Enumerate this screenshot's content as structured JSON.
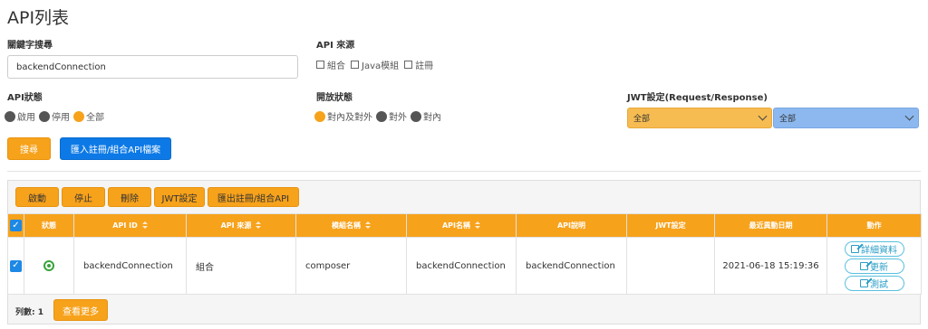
{
  "page": {
    "title": "API列表"
  },
  "filters": {
    "keyword_label": "關鍵字搜尋",
    "keyword_value": "backendConnection",
    "source_label": "API 來源",
    "source_options": [
      "組合",
      "Java模組",
      "註冊"
    ],
    "status_label": "API狀態",
    "status_options": [
      "啟用",
      "停用",
      "全部"
    ],
    "open_label": "開放狀態",
    "open_options": [
      "對內及對外",
      "對外",
      "對內"
    ],
    "jwt_label": "JWT設定(Request/Response)",
    "jwt_request_value": "全部",
    "jwt_response_value": "全部",
    "search_button": "搜尋",
    "import_button": "匯入註冊/組合API檔案"
  },
  "toolbar": {
    "enable": "啟動",
    "disable": "停止",
    "delete": "刪除",
    "jwt": "JWT設定",
    "export": "匯出註冊/組合API"
  },
  "table": {
    "headers": [
      "狀態",
      "API ID",
      "API 來源",
      "模組名稱",
      "API名稱",
      "API說明",
      "JWT設定",
      "最近異動日期",
      "動作"
    ],
    "rows": [
      {
        "api_id": "backendConnection",
        "source": "組合",
        "module": "composer",
        "api_name": "backendConnection",
        "description": "backendConnection",
        "jwt": "",
        "updated": "2021-06-18 15:19:36",
        "actions": [
          "詳細資料",
          "更新",
          "測試"
        ]
      }
    ]
  },
  "footer": {
    "count_text": "列數: 1",
    "more_button": "查看更多"
  },
  "colors": {
    "accent": "#f7a21b",
    "primary": "#0c79e6",
    "status_active": "#3aa33a"
  }
}
